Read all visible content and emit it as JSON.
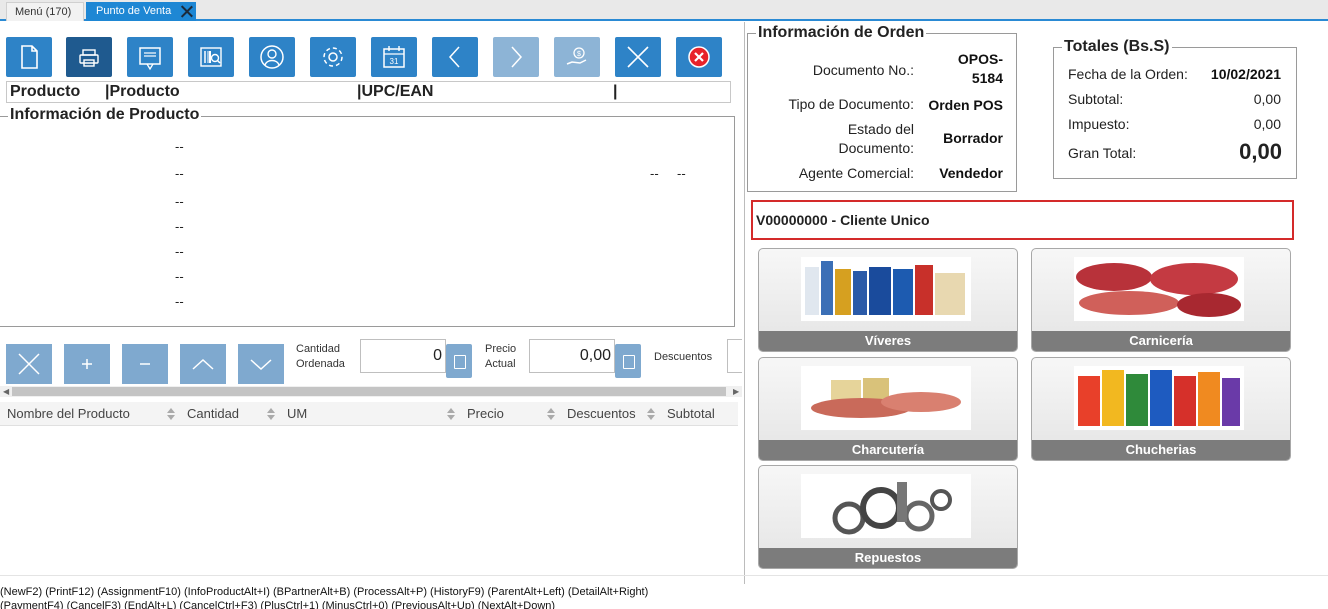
{
  "tabs": [
    {
      "label": "Menú (170)"
    },
    {
      "label": "Punto de Venta"
    }
  ],
  "toolbar": {
    "new_icon": "document-icon",
    "print_icon": "printer-icon",
    "assignment_icon": "receipt-icon",
    "info_product_icon": "barcode-icon",
    "bpartner_icon": "user-icon",
    "process_icon": "gear-icon",
    "history_icon": "calendar-icon",
    "calendar_day": "31",
    "previous_icon": "chevron-left-icon",
    "next_icon": "chevron-right-icon",
    "payment_icon": "hand-coin-icon",
    "cancel_icon": "close-icon",
    "exit_icon": "red-close-icon"
  },
  "search": {
    "col1": "Producto",
    "col2": "|Producto",
    "col3": "|UPC/EAN",
    "col4": "|"
  },
  "product_info": {
    "title": "Información de Producto",
    "dash": "--"
  },
  "quantity": {
    "ordered_label_1": "Cantidad",
    "ordered_label_2": "Ordenada",
    "ordered_value": "0",
    "price_label_1": "Precio",
    "price_label_2": "Actual",
    "price_value": "0,00",
    "discount_label": "Descuentos"
  },
  "grid": {
    "columns": [
      "Nombre del Producto",
      "Cantidad",
      "UM",
      "Precio",
      "Descuentos",
      "Subtotal"
    ]
  },
  "order_info": {
    "title": "Información de Orden",
    "doc_no_label": "Documento No.:",
    "doc_no_value_1": "OPOS-",
    "doc_no_value_2": "5184",
    "doc_type_label": "Tipo de Documento:",
    "doc_type_value": "Orden POS",
    "status_label_1": "Estado del",
    "status_label_2": "Documento:",
    "status_value": "Borrador",
    "agent_label": "Agente Comercial:",
    "agent_value": "Vendedor"
  },
  "totals": {
    "title": "Totales (Bs.S)",
    "date_label": "Fecha de la Orden:",
    "date_value": "10/02/2021",
    "subtotal_label": "Subtotal:",
    "subtotal_value": "0,00",
    "tax_label": "Impuesto:",
    "tax_value": "0,00",
    "grand_label": "Gran Total:",
    "grand_value": "0,00"
  },
  "client": "V00000000 - Cliente Unico",
  "categories": [
    {
      "label": "Víveres"
    },
    {
      "label": "Carnicería"
    },
    {
      "label": "Charcutería"
    },
    {
      "label": "Chucherias"
    },
    {
      "label": "Repuestos"
    }
  ],
  "shortcuts": {
    "line1": "(NewF2) (PrintF12) (AssignmentF10) (InfoProductAlt+I) (BPartnerAlt+B) (ProcessAlt+P) (HistoryF9) (ParentAlt+Left) (DetailAlt+Right)",
    "line2": "(PaymentF4) (CancelF3) (EndAlt+L) (CancelCtrl+F3) (PlusCtrl+1) (MinusCtrl+0) (PreviousAlt+Up) (NextAlt+Down)"
  },
  "colors": {
    "accent": "#2e83c7",
    "tab_active": "#1e87d4",
    "client_border": "#d42a2a",
    "category_caption": "#7c7c7c"
  }
}
